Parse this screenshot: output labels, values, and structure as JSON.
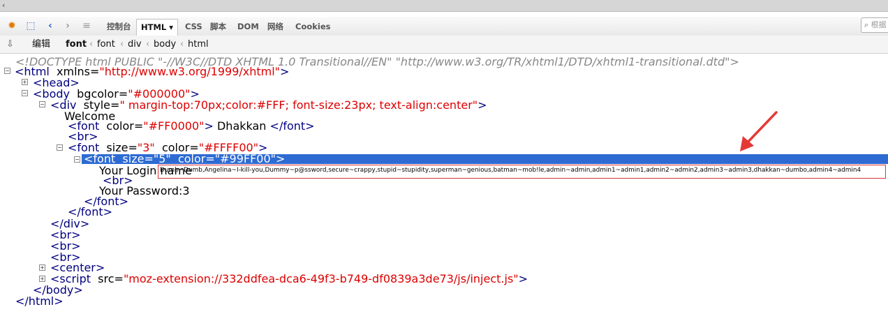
{
  "toolbar": {
    "tabs": [
      "控制台",
      "HTML ▾",
      "CSS",
      "脚本",
      "DOM",
      "网络",
      "Cookies"
    ],
    "search_placeholder": "根据"
  },
  "crumbs": {
    "edit": "编辑",
    "items": [
      "font",
      "font",
      "div",
      "body",
      "html"
    ]
  },
  "code": {
    "doctype": "<!DOCTYPE html PUBLIC \"-//W3C//DTD XHTML 1.0 Transitional//EN\" \"http://www.w3.org/TR/xhtml1/DTD/xhtml1-transitional.dtd\">",
    "html_tag": "<html",
    "html_attr": "xmlns=",
    "html_val": "\"http://www.w3.org/1999/xhtml\"",
    "head": "<head>",
    "body_tag": "<body",
    "body_attr": "bgcolor=",
    "body_val": "\"#000000\"",
    "div_tag": "<div",
    "div_attr": "style=",
    "div_val": "\" margin-top:70px;color:#FFF; font-size:23px; text-align:center\"",
    "welcome": "Welcome",
    "font1_tag": "<font",
    "font1_attr": "color=",
    "font1_val": "\"#FF0000\"",
    "font1_text": "Dhakkan",
    "font_close": "</font>",
    "br": "<br>",
    "font2_tag": "<font",
    "font2_attr1": "size=",
    "font2_val1": "\"3\"",
    "font2_attr2": "color=",
    "font2_val2": "\"#FFFF00\"",
    "font3_tag": "<font",
    "font3_attr1": "size=",
    "font3_val1": "\"5\"",
    "font3_attr2": "color=",
    "font3_val2": "\"#99FF00\"",
    "login_label": "Your Login name",
    "login_value": "Dumb~Dumb,Angelina~I-kill-you,Dummy~p@ssword,secure~crappy,stupid~stupidity,superman~genious,batman~mob!le,admin~admin,admin1~admin1,admin2~admin2,admin3~admin3,dhakkan~dumbo,admin4~admin4",
    "password": "Your Password:3",
    "div_close": "</div>",
    "center": "<center>",
    "script_tag": "<script",
    "script_attr": "src=",
    "script_val": "\"moz-extension://332ddfea-dca6-49f3-b749-df0839a3de73/js/inject.js\"",
    "body_close": "</body>",
    "html_close": "</html>"
  },
  "colors": {
    "selection": "#2d6bd3",
    "highlight_box": "#d9353a",
    "arrow": "#e53935"
  }
}
